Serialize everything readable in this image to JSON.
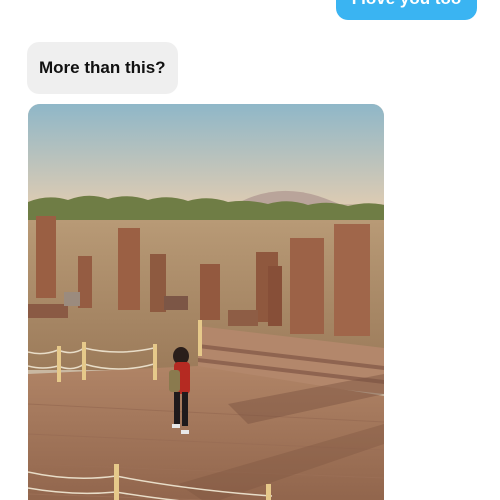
{
  "conversation": {
    "messages": [
      {
        "direction": "outgoing",
        "text": "I love you too"
      },
      {
        "direction": "incoming",
        "text": "More than this?"
      }
    ],
    "attachment": {
      "type": "video",
      "scene": "woman-standing-on-wooden-deck-among-stone-gravestones-at-sunset"
    }
  },
  "colors": {
    "outgoing_bubble": "#3ab4f2",
    "incoming_bubble": "#efefef",
    "background": "#ffffff"
  }
}
